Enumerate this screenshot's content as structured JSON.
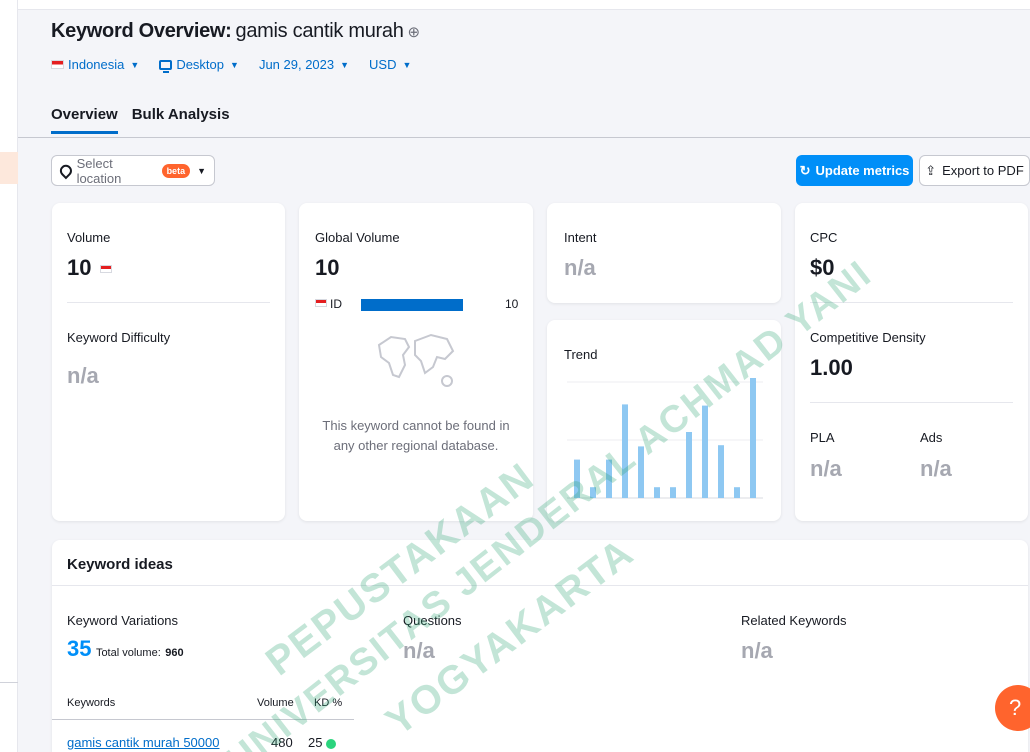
{
  "header": {
    "title_prefix": "Keyword Overview:",
    "keyword": "gamis cantik murah",
    "plus_icon": "⊕",
    "filters": {
      "country": "Indonesia",
      "device": "Desktop",
      "date": "Jun 29, 2023",
      "currency": "USD"
    },
    "tabs": [
      "Overview",
      "Bulk Analysis"
    ]
  },
  "toolbar": {
    "location_placeholder": "Select location",
    "beta_label": "beta",
    "update_label": "Update metrics",
    "export_label": "Export to PDF"
  },
  "volume_card": {
    "volume_label": "Volume",
    "volume_value": "10",
    "kd_label": "Keyword Difficulty",
    "kd_value": "n/a"
  },
  "global_card": {
    "label": "Global Volume",
    "value": "10",
    "country_code": "ID",
    "country_value": "10",
    "empty_message": "This keyword cannot be found in any other regional database."
  },
  "intent_card": {
    "label": "Intent",
    "value": "n/a"
  },
  "trend_card": {
    "label": "Trend",
    "values": [
      0.32,
      0.09,
      0.32,
      0.78,
      0.43,
      0.09,
      0.09,
      0.55,
      0.77,
      0.44,
      0.09,
      1.0
    ],
    "bar_color": "#8ec8f2"
  },
  "cpc_card": {
    "cpc_label": "CPC",
    "cpc_value": "$0",
    "density_label": "Competitive Density",
    "density_value": "1.00",
    "pla_label": "PLA",
    "pla_value": "n/a",
    "ads_label": "Ads",
    "ads_value": "n/a"
  },
  "keyword_ideas": {
    "title": "Keyword ideas",
    "variations_label": "Keyword Variations",
    "variations_count": "35",
    "total_volume_label": "Total volume:",
    "total_volume_value": "960",
    "questions_label": "Questions",
    "questions_value": "n/a",
    "related_label": "Related Keywords",
    "related_value": "n/a",
    "table_headers": [
      "Keywords",
      "Volume",
      "KD %"
    ],
    "rows": [
      {
        "keyword": "gamis cantik murah 50000",
        "volume": "480",
        "kd": "25"
      }
    ]
  },
  "help_label": "?",
  "watermark": [
    "PEPUSTAKAAN",
    "UNIVERSITAS JENDERAL ACHMAD YANI",
    "YOGYAKARTA"
  ],
  "colors": {
    "accent": "#006dca",
    "button": "#008ff8",
    "brand_orange": "#ff642d",
    "kd_dot": "#2bd47d"
  }
}
